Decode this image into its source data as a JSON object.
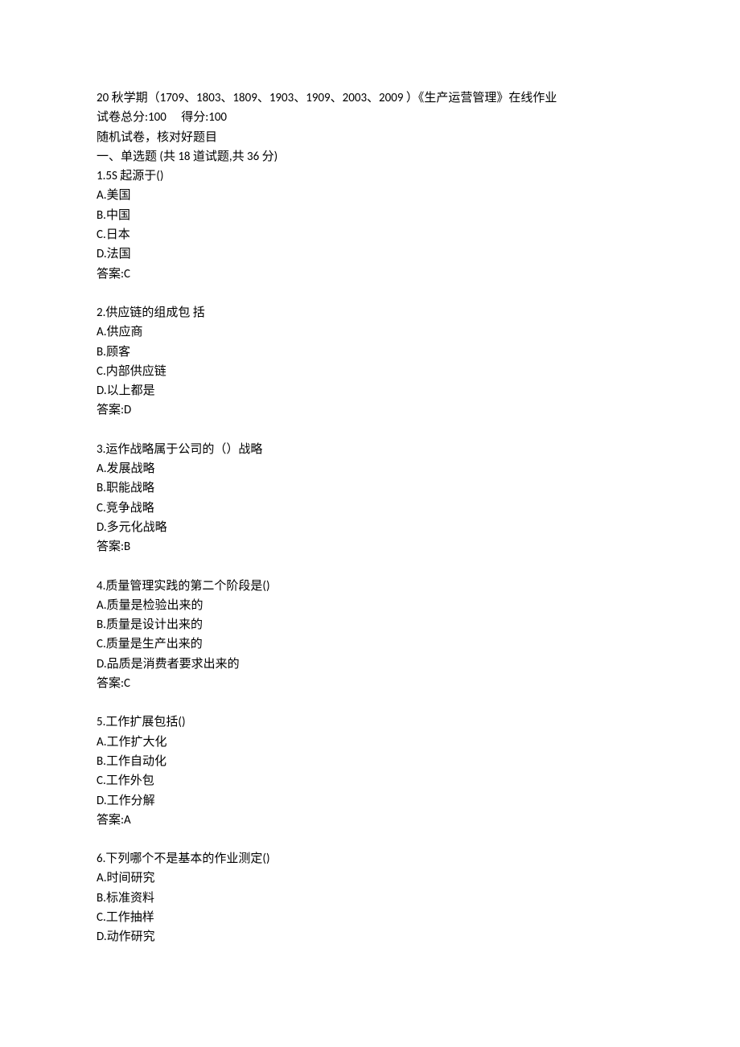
{
  "header": {
    "title": "20 秋学期（1709、1803、1809、1903、1909、2003、2009 ）《生产运营管理》在线作业",
    "score_line": "试卷总分:100  得分:100",
    "note": "随机试卷，核对好题目",
    "section": "一、单选题 (共 18 道试题,共 36 分)"
  },
  "questions": [
    {
      "stem": "1.5S 起源于()",
      "options": [
        "A.美国",
        "B.中国",
        "C.日本",
        "D.法国"
      ],
      "answer": "答案:C"
    },
    {
      "stem": "2.供应链的组成包 括",
      "options": [
        "A.供应商",
        "B.顾客",
        "C.内部供应链",
        "D.以上都是"
      ],
      "answer": "答案:D"
    },
    {
      "stem": "3.运作战略属于公司的（）战略",
      "options": [
        "A.发展战略",
        "B.职能战略",
        "C.竞争战略",
        "D.多元化战略"
      ],
      "answer": "答案:B"
    },
    {
      "stem": "4.质量管理实践的第二个阶段是()",
      "options": [
        "A.质量是检验出来的",
        "B.质量是设计出来的",
        "C.质量是生产出来的",
        "D.品质是消费者要求出来的"
      ],
      "answer": "答案:C"
    },
    {
      "stem": "5.工作扩展包括()",
      "options": [
        "A.工作扩大化",
        "B.工作自动化",
        "C.工作外包",
        "D.工作分解"
      ],
      "answer": "答案:A"
    },
    {
      "stem": "6.下列哪个不是基本的作业测定()",
      "options": [
        "A.时间研究",
        "B.标准资料",
        "C.工作抽样",
        "D.动作研究"
      ],
      "answer": null
    }
  ]
}
